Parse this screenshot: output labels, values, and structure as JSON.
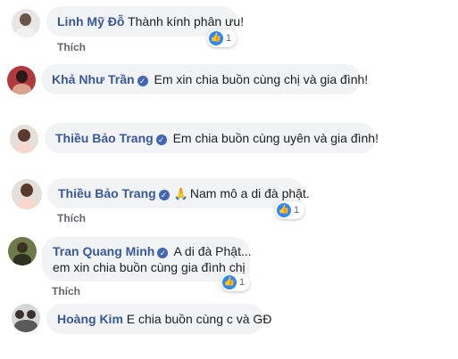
{
  "comments": [
    {
      "author": "Linh Mỹ Đỗ",
      "verified": false,
      "text": "Thành kính phân ưu!",
      "like_label": "Thích",
      "reaction_count": "1"
    },
    {
      "author": "Khả Như Trần",
      "verified": true,
      "text": "Em xin chia buồn cùng chị và gia đình!"
    },
    {
      "author": "Thiều Bảo Trang",
      "verified": true,
      "text": "Em chia buồn cùng uyên và gia đình!"
    },
    {
      "author": "Thiều Bảo Trang",
      "verified": true,
      "emoji": "🙏",
      "text": "Nam mô a di đà phật.",
      "like_label": "Thích",
      "reaction_count": "1"
    },
    {
      "author": "Tran Quang Minh",
      "verified": true,
      "text": "A di đà Phật...",
      "text_line2": "em xin chia buồn cùng gia đình chị",
      "like_label": "Thích",
      "reaction_count": "1"
    },
    {
      "author": "Hoàng Kim",
      "verified": false,
      "text": "E chia buồn cùng c và GĐ"
    }
  ],
  "icons": {
    "verified": "✓",
    "like": "👍"
  }
}
